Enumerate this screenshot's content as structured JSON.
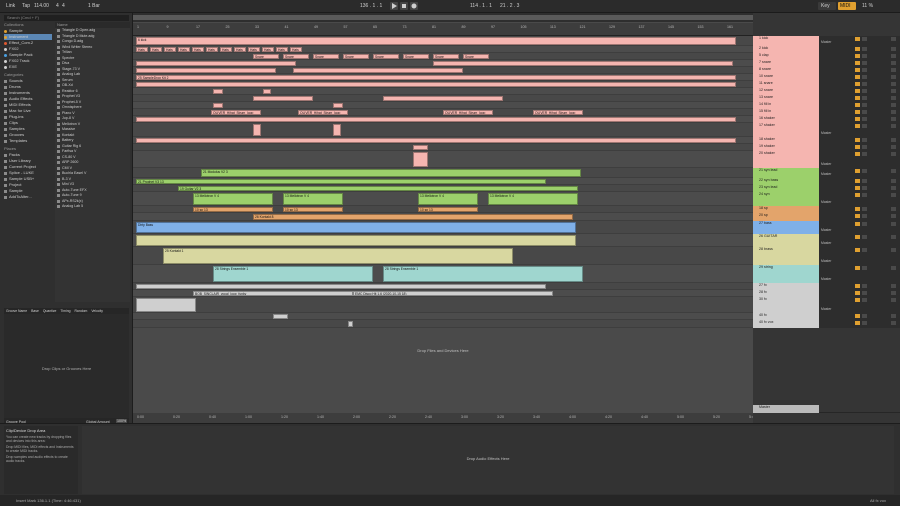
{
  "topbar": {
    "link": "Link",
    "tap": "Tap",
    "tempo": "114.00",
    "sig_num": "4",
    "sig_den": "4",
    "quant": "1 Bar",
    "position": "136 . 1 . 1",
    "loop_start": "114 . 1 . 1",
    "loop_len": "21 . 2 . 3",
    "key": "Key",
    "midi": "MIDI",
    "cpu": "11 %"
  },
  "browser": {
    "search_placeholder": "Search (Cmd + F)",
    "collections_header": "Collections",
    "collections": [
      {
        "label": "Sample",
        "color": "#e0a030"
      },
      {
        "label": "Instrument",
        "color": "#e0a030"
      },
      {
        "label": "Effect_Com.2",
        "color": "#e05a30"
      },
      {
        "label": "FX02",
        "color": "#cfcfcf"
      },
      {
        "label": "Sample Pack",
        "color": "#4aa0e0"
      },
      {
        "label": "FX02 Track",
        "color": "#cfcfcf"
      },
      {
        "label": "EXE",
        "color": "#cfcfcf"
      }
    ],
    "categories_header": "Categories",
    "categories": [
      "Sounds",
      "Drums",
      "Instruments",
      "Audio Effects",
      "MIDI Effects",
      "Max for Live",
      "Plug-ins",
      "Clips",
      "Samples",
      "Grooves",
      "Templates"
    ],
    "places_header": "Places",
    "places": [
      "Packs",
      "User Library",
      "Current Project",
      "Splice - LUKE",
      "Sample USB+",
      "Project",
      "Sample",
      "AddToAlter..."
    ],
    "names_header": "Name",
    "names": [
      "Triangle D Open.adg",
      "Triangle D Mute.adg",
      "Congo D.adg",
      "Wind Writer Stereo",
      "Trilian",
      "Spectre",
      "Diva",
      "Stage-73 V",
      "Analog Lab",
      "Serum",
      "OB-Xd",
      "Reaktor 6",
      "Prophet V3",
      "Prophet-5 V",
      "Omnisphere",
      "Piano V",
      "Jup-8 V",
      "Mellotron V",
      "Massive",
      "Kontakt",
      "Battery",
      "Guitar Rig 6",
      "Farfisa V",
      "CS-80 V",
      "ARP 2600",
      "CMI V",
      "Buchla Easel V",
      "B-3 V",
      "Mini V3",
      "Auto-Tune EFX",
      "Auto-Tune 9",
      "APx-RS2k(x)",
      "Analog Lab 5"
    ],
    "groove_cols": [
      "Groove Name",
      "Base",
      "Quantize",
      "Timing",
      "Random",
      "Velocity"
    ],
    "groove_empty": "Drop Clips or Grooves Here",
    "groove_pool": "Groove Pool",
    "global_amount_label": "Global Amount",
    "global_amount": "100%"
  },
  "arrangement": {
    "bars": [
      "1",
      "9",
      "17",
      "25",
      "33",
      "41",
      "49",
      "57",
      "65",
      "73",
      "81",
      "89",
      "97",
      "105",
      "113",
      "121",
      "129",
      "137",
      "145",
      "153",
      "161"
    ],
    "time_ticks": [
      "0:00",
      "0:20",
      "0:40",
      "1:00",
      "1:20",
      "1:40",
      "2:00",
      "2:20",
      "2:40",
      "3:00",
      "3:20",
      "3:40",
      "4:00",
      "4:20",
      "4:40",
      "5:00",
      "5:20",
      "5:40"
    ],
    "drop_hint": "Drop Files and Devices Here",
    "clip_labels": {
      "kick": "6 kick",
      "hats": "Hats",
      "snare": "Snare",
      "sample_drop": "25 SampleDrop Kit 2",
      "oliver1": "OLIVER_Hihat_Strum_loop",
      "oliver2": "OLIVER_Hihat_Strum_loop",
      "oliver3": "OLIVER_Hihat_Strum_loop",
      "oliver4": "OLIVER_Hihat_Strum_loop",
      "modulus": "21 Modulus V2 3",
      "prophet": "21 Prophet V3 13",
      "guitar": "19 Guitar V2 3",
      "mellotron1": "13 Mellotron V 4",
      "mellotron2": "13 Mellotron V 4",
      "mellotron3": "13 Mellotron V 4",
      "mellotron4": "13 Mellotron V 4",
      "kontakt": "26 Kontakt 8",
      "kontakt2": "26 Kontakt 8",
      "spc1": "10 sp 13",
      "spc2": "10 sp 13",
      "spc3": "10 sp 13",
      "dirty": "Dirty Bass",
      "kontakt3": "25 Kontakt 1",
      "strings1": "28 Strings Ensemble 1",
      "strings2": "28 Strings Ensemble 1",
      "bob": "BOB_SINCLAIR_vocal_loop_funky",
      "emc": "EMC Disco Hit 1.6 (2020-10-15 18)"
    }
  },
  "mixer": {
    "tracks": [
      {
        "name": "1 kick",
        "color": "#f5b5b0",
        "h": 10
      },
      {
        "name": "2 kick",
        "color": "#f5b5b0",
        "h": 7
      },
      {
        "name": "5 clap",
        "color": "#f5b5b0",
        "h": 7
      },
      {
        "name": "7 snare",
        "color": "#f5b5b0",
        "h": 7
      },
      {
        "name": "8 snare",
        "color": "#f5b5b0",
        "h": 7
      },
      {
        "name": "10 snare",
        "color": "#f5b5b0",
        "h": 7
      },
      {
        "name": "11 snare",
        "color": "#f5b5b0",
        "h": 7
      },
      {
        "name": "12 snare",
        "color": "#f5b5b0",
        "h": 7
      },
      {
        "name": "13 snare",
        "color": "#f5b5b0",
        "h": 7
      },
      {
        "name": "14 fill in",
        "color": "#f5b5b0",
        "h": 7
      },
      {
        "name": "15 fill in",
        "color": "#f5b5b0",
        "h": 7
      },
      {
        "name": "16 shaker",
        "color": "#f5b5b0",
        "h": 7
      },
      {
        "name": "17 shaker",
        "color": "#f5b5b0",
        "h": 14
      },
      {
        "name": "18 shaker",
        "color": "#f5b5b0",
        "h": 7
      },
      {
        "name": "19 shaker",
        "color": "#f5b5b0",
        "h": 7
      },
      {
        "name": "20 shaker",
        "color": "#f5b5b0",
        "h": 17
      },
      {
        "name": "21 syn lead",
        "color": "#9cd06b",
        "h": 10
      },
      {
        "name": "22 syn bass",
        "color": "#9cd06b",
        "h": 7
      },
      {
        "name": "23 syn lead",
        "color": "#9cd06b",
        "h": 7
      },
      {
        "name": "24 syn",
        "color": "#9cd06b",
        "h": 14
      },
      {
        "name": "18 sp",
        "color": "#e3a46b",
        "h": 7
      },
      {
        "name": "20 sp",
        "color": "#e3a46b",
        "h": 8
      },
      {
        "name": "27 bass",
        "color": "#7fb0e8",
        "h": 13
      },
      {
        "name": "26 GUITAR",
        "color": "#d8d7a0",
        "h": 13
      },
      {
        "name": "28 brass",
        "color": "#d8d7a0",
        "h": 18
      },
      {
        "name": "29 string",
        "color": "#9fd6cf",
        "h": 18
      },
      {
        "name": "27 fx",
        "color": "#cfcfcf",
        "h": 7
      },
      {
        "name": "28 fx",
        "color": "#cfcfcf",
        "h": 7
      },
      {
        "name": "30 fx",
        "color": "#cfcfcf",
        "h": 16
      },
      {
        "name": "40 fx",
        "color": "#cfcfcf",
        "h": 7
      },
      {
        "name": "40 fx vox",
        "color": "#cfcfcf",
        "h": 8
      }
    ],
    "master_label": "Master",
    "master_track": "Master",
    "routing": "Master",
    "solo": "S",
    "arm": "Auto"
  },
  "bottom": {
    "clip_drop_title": "Clip/Device Drop Area",
    "clip_drop_text": "You can create new tracks by dropping files and devices into this area:",
    "clip_drop_b1": "Drop MIDI files, MIDI effects and Instruments to create MIDI tracks.",
    "clip_drop_b2": "Drop samples and audio effects to create audio tracks.",
    "drop_effects": "Drop Audio Effects Here"
  },
  "status": {
    "left": "Insert Mark 136.1.1 (Time: 4:46:431)",
    "right": "All fx vox"
  }
}
